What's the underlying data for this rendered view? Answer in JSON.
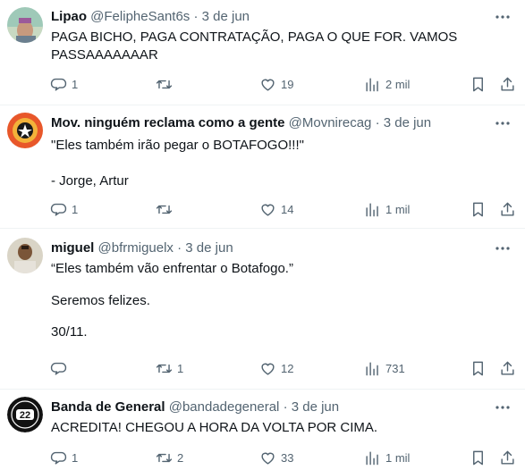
{
  "tweets": [
    {
      "name": "Lipao",
      "handle": "@FelipheSant6s",
      "sep": "·",
      "date": "3 de jun",
      "text": "PAGA BICHO, PAGA CONTRATAÇÃO, PAGA O QUE FOR. VAMOS\nPASSAAAAAAAR",
      "replies": "1",
      "retweets": "",
      "likes": "19",
      "views": "2 mil"
    },
    {
      "name": "Mov. ninguém reclama como a gente",
      "handle": "@Movnirecag",
      "sep": "·",
      "date": "3 de jun",
      "text": "\"Eles também irão pegar o BOTAFOGO!!!\"\n\n- Jorge, Artur",
      "replies": "1",
      "retweets": "",
      "likes": "14",
      "views": "1 mil"
    },
    {
      "name": "miguel",
      "handle": "@bfrmiguelx",
      "sep": "·",
      "date": "3 de jun",
      "text": "“Eles também vão enfrentar o Botafogo.”\n\nSeremos felizes.\n\n30/11.",
      "replies": "",
      "retweets": "1",
      "likes": "12",
      "views": "731"
    },
    {
      "name": "Banda de General",
      "handle": "@bandadegeneral",
      "sep": "·",
      "date": "3 de jun",
      "text": "ACREDITA! CHEGOU A HORA DA VOLTA POR CIMA.",
      "replies": "1",
      "retweets": "2",
      "likes": "33",
      "views": "1 mil"
    }
  ],
  "avatars": {
    "banda_badge_number": "22"
  },
  "icons": [
    "more-icon",
    "reply-icon",
    "retweet-icon",
    "like-icon",
    "views-icon",
    "bookmark-icon",
    "share-icon"
  ],
  "colors": {
    "text": "#0f1419",
    "muted": "#536471",
    "divider": "#eff3f4"
  }
}
